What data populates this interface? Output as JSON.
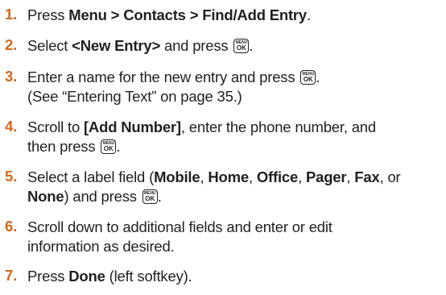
{
  "key": {
    "top": "MENU",
    "bottom": "OK"
  },
  "steps": [
    {
      "num": "1.",
      "a": "Press ",
      "b1": "Menu > Contacts > Find/Add Entry",
      "c": "."
    },
    {
      "num": "2.",
      "a": "Select ",
      "b1": "<New Entry>",
      "c": " and press ",
      "d": "."
    },
    {
      "num": "3.",
      "a": "Enter a name for the new entry and press ",
      "b": ".",
      "l2": "(See “Entering Text” on page 35.)"
    },
    {
      "num": "4.",
      "a": "Scroll to ",
      "b1": "[Add Number]",
      "c": ", enter the phone number, and",
      "l2a": "then press ",
      "l2b": "."
    },
    {
      "num": "5.",
      "a": "Select a label field (",
      "b1": "Mobile",
      "s1": ", ",
      "b2": "Home",
      "s2": ", ",
      "b3": "Office",
      "s3": ", ",
      "b4": "Pager",
      "s4": ", ",
      "b5": "Fax",
      "s5": ", or",
      "b6": "None",
      "l2a": ") and press ",
      "l2b": "."
    },
    {
      "num": "6.",
      "l1": "Scroll down to additional fields and enter or edit",
      "l2": "information as desired."
    },
    {
      "num": "7.",
      "a": "Press ",
      "b1": "Done",
      "c": " (left softkey)."
    }
  ]
}
